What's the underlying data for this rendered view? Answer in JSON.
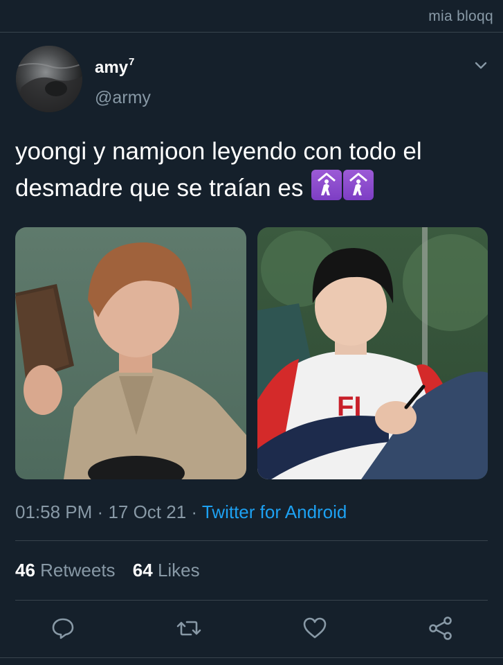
{
  "watermark": "mia bloqq",
  "author": {
    "display_name": "amy",
    "display_name_sup": "7",
    "handle": "@army"
  },
  "tweet": {
    "text": "yoongi y namjoon leyendo con todo el desmadre que se traían es",
    "emoji": [
      "place-of-worship-icon",
      "place-of-worship-icon"
    ],
    "media": [
      "photo-man-reading-book",
      "photo-man-writing-in-chair"
    ]
  },
  "meta": {
    "time": "01:58 PM",
    "separator": "·",
    "date": "17 Oct 21",
    "source": "Twitter for Android"
  },
  "stats": {
    "retweets_count": "46",
    "retweets_label": "Retweets",
    "likes_count": "64",
    "likes_label": "Likes"
  },
  "actions": [
    "reply-icon",
    "retweet-icon",
    "like-icon",
    "share-icon"
  ],
  "colors": {
    "background": "#15202b",
    "secondary_text": "#8899a6",
    "link": "#1da1f2",
    "divider": "#38444d",
    "emoji_bg": "#8e4dd0"
  }
}
